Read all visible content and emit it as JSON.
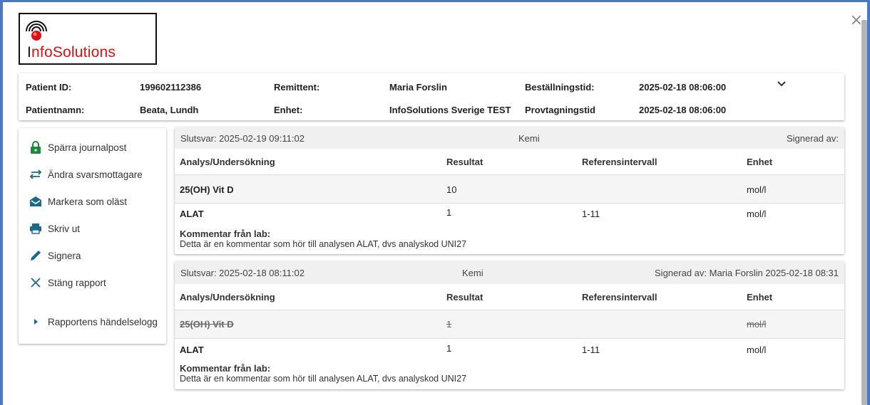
{
  "logo": {
    "text_initial": "I",
    "text_rest": "nfoSolutions"
  },
  "header": {
    "patient_id_label": "Patient ID:",
    "patient_id": "199602112386",
    "remittent_label": "Remittent:",
    "remittent": "Maria Forslin",
    "bestallningstid_label": "Beställningstid:",
    "bestallningstid": "2025-02-18 08:06:00",
    "patientnamn_label": "Patientnamn:",
    "patientnamn": "Beata, Lundh",
    "enhet_label": "Enhet:",
    "enhet": "InfoSolutions Sverige TEST",
    "provtagningstid_label": "Provtagningstid",
    "provtagningstid": "2025-02-18 08:06:00",
    "expand_icon": "chevron-down-icon"
  },
  "sidebar": {
    "items": [
      {
        "label": "Spärra journalpost",
        "icon": "lock-icon"
      },
      {
        "label": "Ändra svarsmottagare",
        "icon": "swap-arrows-icon"
      },
      {
        "label": "Markera som oläst",
        "icon": "envelope-open-icon"
      },
      {
        "label": "Skriv ut",
        "icon": "printer-icon"
      },
      {
        "label": "Signera",
        "icon": "pen-icon"
      },
      {
        "label": "Stäng rapport",
        "icon": "close-x-icon"
      },
      {
        "label": "Rapportens händelselogg",
        "icon": "caret-right-icon"
      }
    ]
  },
  "reports": [
    {
      "slutsvar": "Slutsvar: 2025-02-19 09:11:02",
      "category": "Kemi",
      "signed": "Signerad av:",
      "columns": {
        "analysis": "Analys/Undersökning",
        "result": "Resultat",
        "reference": "Referensintervall",
        "unit": "Enhet"
      },
      "rows": [
        {
          "analysis": "25(OH) Vit D",
          "result": "10",
          "reference": "",
          "unit": "mol/l"
        },
        {
          "analysis": "ALAT",
          "result": "1",
          "reference": "1-11",
          "unit": "mol/l"
        }
      ],
      "comment_label": "Kommentar från lab:",
      "comment_text": "Detta är en kommentar som hör till analysen ALAT, dvs analyskod UNI27"
    },
    {
      "slutsvar": "Slutsvar: 2025-02-18 08:11:02",
      "category": "Kemi",
      "signed": "Signerad av: Maria Forslin 2025-02-18 08:31",
      "columns": {
        "analysis": "Analys/Undersökning",
        "result": "Resultat",
        "reference": "Referensintervall",
        "unit": "Enhet"
      },
      "rows": [
        {
          "analysis": "25(OH) Vit D",
          "result": "1",
          "reference": "",
          "unit": "mol/l"
        },
        {
          "analysis": "ALAT",
          "result": "1",
          "reference": "1-11",
          "unit": "mol/l"
        }
      ],
      "comment_label": "Kommentar från lab:",
      "comment_text": "Detta är en kommentar som hör till analysen ALAT, dvs analyskod UNI27"
    }
  ],
  "colors": {
    "frame": "#4a78c2",
    "logo_red": "#dd1111",
    "icon": "#333333"
  }
}
